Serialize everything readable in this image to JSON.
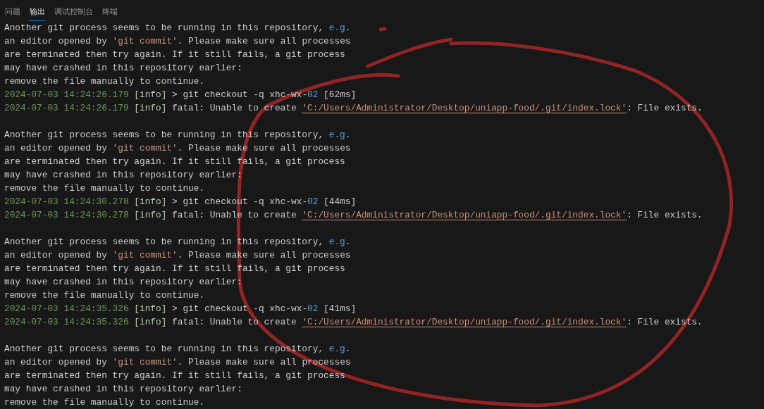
{
  "tabs": [
    {
      "label": "问题",
      "selected": false
    },
    {
      "label": "输出",
      "selected": true
    },
    {
      "label": "调试控制台",
      "selected": false
    },
    {
      "label": "终端",
      "selected": false
    }
  ],
  "lines": [
    {
      "kind": "text",
      "parts": [
        {
          "kind": "plain",
          "text": "Another git process seems to be running in this repository, "
        },
        {
          "kind": "keyword",
          "text": "e.g"
        },
        {
          "kind": "plain",
          "text": "."
        }
      ]
    },
    {
      "kind": "text",
      "parts": [
        {
          "kind": "plain",
          "text": "an editor opened by "
        },
        {
          "kind": "string",
          "text": "'git commit'"
        },
        {
          "kind": "plain",
          "text": ". Please make sure all processes"
        }
      ]
    },
    {
      "kind": "text",
      "parts": [
        {
          "kind": "plain",
          "text": "are terminated then try again. If it still fails, a git process"
        }
      ]
    },
    {
      "kind": "text",
      "parts": [
        {
          "kind": "plain",
          "text": "may have crashed in this repository earlier:"
        }
      ]
    },
    {
      "kind": "text",
      "parts": [
        {
          "kind": "plain",
          "text": "remove the file manually to continue."
        }
      ]
    },
    {
      "kind": "text",
      "parts": [
        {
          "kind": "timestamp",
          "text": "2024-07-03 14:24:26.179"
        },
        {
          "kind": "tag",
          "text": "[info]"
        },
        {
          "kind": "plain",
          "text": " > git checkout -q xhc-wx-"
        },
        {
          "kind": "keyword",
          "text": "02"
        },
        {
          "kind": "plain",
          "text": " [62ms]"
        }
      ]
    },
    {
      "kind": "text",
      "parts": [
        {
          "kind": "timestamp",
          "text": "2024-07-03 14:24:26.179"
        },
        {
          "kind": "tag",
          "text": "[info]"
        },
        {
          "kind": "plain",
          "text": " fatal: Unable to create "
        },
        {
          "kind": "path",
          "text": "'C:/Users/Administrator/Desktop/uniapp-food/.git/index.lock'"
        },
        {
          "kind": "plain",
          "text": ": File exists."
        }
      ]
    },
    {
      "kind": "blank"
    },
    {
      "kind": "text",
      "parts": [
        {
          "kind": "plain",
          "text": "Another git process seems to be running in this repository, "
        },
        {
          "kind": "keyword",
          "text": "e.g"
        },
        {
          "kind": "plain",
          "text": "."
        }
      ]
    },
    {
      "kind": "text",
      "parts": [
        {
          "kind": "plain",
          "text": "an editor opened by "
        },
        {
          "kind": "string",
          "text": "'git commit'"
        },
        {
          "kind": "plain",
          "text": ". Please make sure all processes"
        }
      ]
    },
    {
      "kind": "text",
      "parts": [
        {
          "kind": "plain",
          "text": "are terminated then try again. If it still fails, a git process"
        }
      ]
    },
    {
      "kind": "text",
      "parts": [
        {
          "kind": "plain",
          "text": "may have crashed in this repository earlier:"
        }
      ]
    },
    {
      "kind": "text",
      "parts": [
        {
          "kind": "plain",
          "text": "remove the file manually to continue."
        }
      ]
    },
    {
      "kind": "text",
      "parts": [
        {
          "kind": "timestamp",
          "text": "2024-07-03 14:24:30.278"
        },
        {
          "kind": "tag",
          "text": "[info]"
        },
        {
          "kind": "plain",
          "text": " > git checkout -q xhc-wx-"
        },
        {
          "kind": "keyword",
          "text": "02"
        },
        {
          "kind": "plain",
          "text": " [44ms]"
        }
      ]
    },
    {
      "kind": "text",
      "parts": [
        {
          "kind": "timestamp",
          "text": "2024-07-03 14:24:30.278"
        },
        {
          "kind": "tag",
          "text": "[info]"
        },
        {
          "kind": "plain",
          "text": " fatal: Unable to create "
        },
        {
          "kind": "path",
          "text": "'C:/Users/Administrator/Desktop/uniapp-food/.git/index.lock'"
        },
        {
          "kind": "plain",
          "text": ": File exists."
        }
      ]
    },
    {
      "kind": "blank"
    },
    {
      "kind": "text",
      "parts": [
        {
          "kind": "plain",
          "text": "Another git process seems to be running in this repository, "
        },
        {
          "kind": "keyword",
          "text": "e.g"
        },
        {
          "kind": "plain",
          "text": "."
        }
      ]
    },
    {
      "kind": "text",
      "parts": [
        {
          "kind": "plain",
          "text": "an editor opened by "
        },
        {
          "kind": "string",
          "text": "'git commit'"
        },
        {
          "kind": "plain",
          "text": ". Please make sure all processes"
        }
      ]
    },
    {
      "kind": "text",
      "parts": [
        {
          "kind": "plain",
          "text": "are terminated then try again. If it still fails, a git process"
        }
      ]
    },
    {
      "kind": "text",
      "parts": [
        {
          "kind": "plain",
          "text": "may have crashed in this repository earlier:"
        }
      ]
    },
    {
      "kind": "text",
      "parts": [
        {
          "kind": "plain",
          "text": "remove the file manually to continue."
        }
      ]
    },
    {
      "kind": "text",
      "parts": [
        {
          "kind": "timestamp",
          "text": "2024-07-03 14:24:35.326"
        },
        {
          "kind": "tag",
          "text": "[info]"
        },
        {
          "kind": "plain",
          "text": " > git checkout -q xhc-wx-"
        },
        {
          "kind": "keyword",
          "text": "02"
        },
        {
          "kind": "plain",
          "text": " [41ms]"
        }
      ]
    },
    {
      "kind": "text",
      "parts": [
        {
          "kind": "timestamp",
          "text": "2024-07-03 14:24:35.326"
        },
        {
          "kind": "tag",
          "text": "[info]"
        },
        {
          "kind": "plain",
          "text": " fatal: Unable to create "
        },
        {
          "kind": "path",
          "text": "'C:/Users/Administrator/Desktop/uniapp-food/.git/index.lock'"
        },
        {
          "kind": "plain",
          "text": ": File exists."
        }
      ]
    },
    {
      "kind": "blank"
    },
    {
      "kind": "text",
      "parts": [
        {
          "kind": "plain",
          "text": "Another git process seems to be running in this repository, "
        },
        {
          "kind": "keyword",
          "text": "e.g"
        },
        {
          "kind": "plain",
          "text": "."
        }
      ]
    },
    {
      "kind": "text",
      "parts": [
        {
          "kind": "plain",
          "text": "an editor opened by "
        },
        {
          "kind": "string",
          "text": "'git commit'"
        },
        {
          "kind": "plain",
          "text": ". Please make sure all processes"
        }
      ]
    },
    {
      "kind": "text",
      "parts": [
        {
          "kind": "plain",
          "text": "are terminated then try again. If it still fails, a git process"
        }
      ]
    },
    {
      "kind": "text",
      "parts": [
        {
          "kind": "plain",
          "text": "may have crashed in this repository earlier:"
        }
      ]
    },
    {
      "kind": "text",
      "parts": [
        {
          "kind": "plain",
          "text": "remove the file manually to continue."
        }
      ]
    }
  ]
}
